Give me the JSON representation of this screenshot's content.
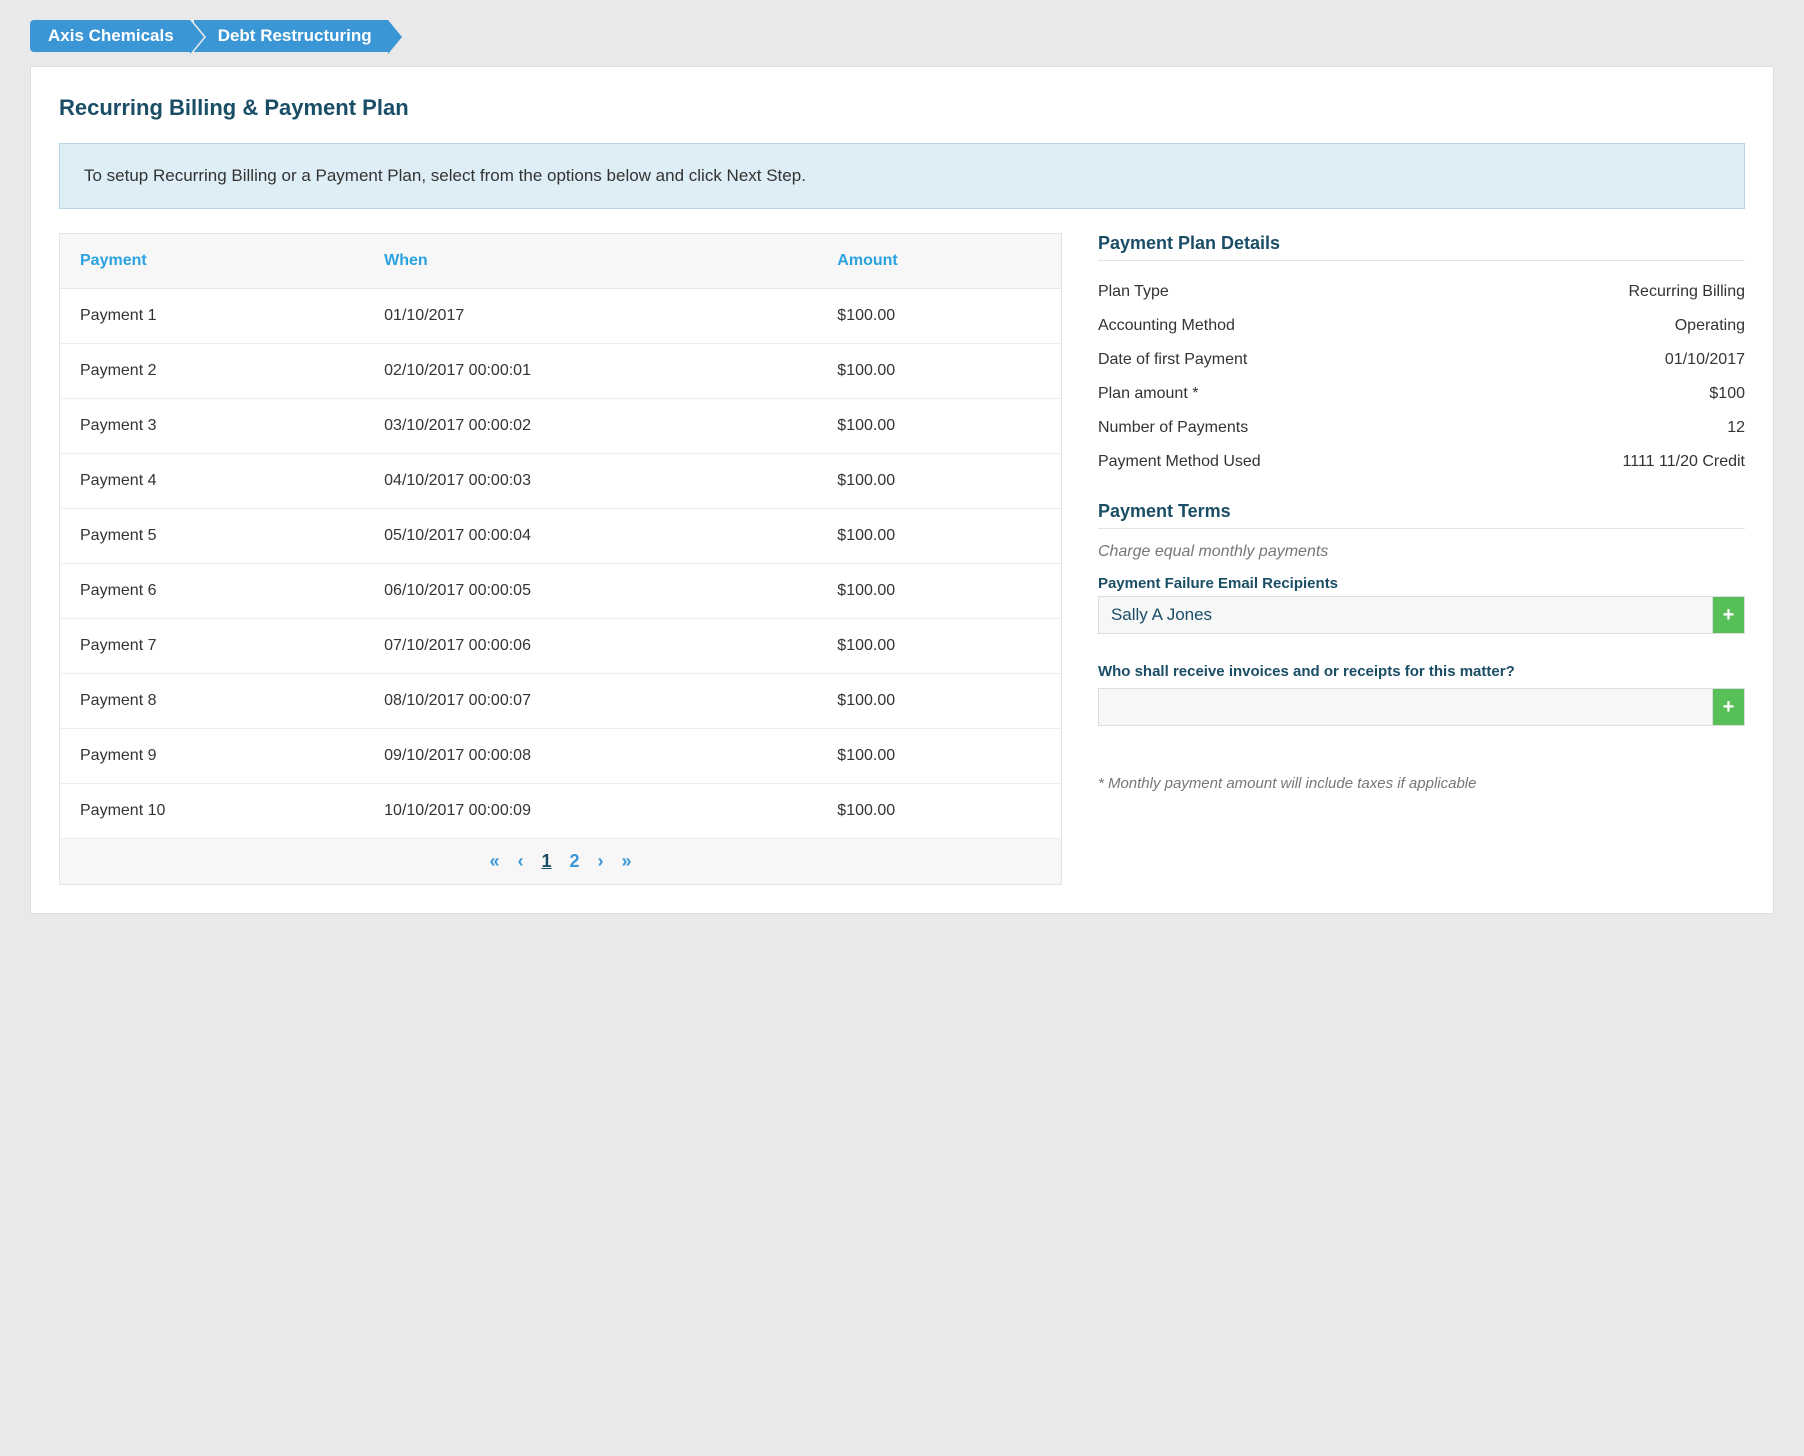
{
  "breadcrumb": {
    "item1": "Axis Chemicals",
    "item2": "Debt Restructuring"
  },
  "page": {
    "title": "Recurring Billing & Payment Plan",
    "info": "To setup Recurring Billing or a Payment Plan, select from the options below and click Next Step."
  },
  "table": {
    "headers": {
      "payment": "Payment",
      "when": "When",
      "amount": "Amount"
    },
    "rows": [
      {
        "payment": "Payment 1",
        "when": "01/10/2017",
        "amount": "$100.00"
      },
      {
        "payment": "Payment 2",
        "when": "02/10/2017 00:00:01",
        "amount": "$100.00"
      },
      {
        "payment": "Payment 3",
        "when": "03/10/2017 00:00:02",
        "amount": "$100.00"
      },
      {
        "payment": "Payment 4",
        "when": "04/10/2017 00:00:03",
        "amount": "$100.00"
      },
      {
        "payment": "Payment 5",
        "when": "05/10/2017 00:00:04",
        "amount": "$100.00"
      },
      {
        "payment": "Payment 6",
        "when": "06/10/2017 00:00:05",
        "amount": "$100.00"
      },
      {
        "payment": "Payment 7",
        "when": "07/10/2017 00:00:06",
        "amount": "$100.00"
      },
      {
        "payment": "Payment 8",
        "when": "08/10/2017 00:00:07",
        "amount": "$100.00"
      },
      {
        "payment": "Payment 9",
        "when": "09/10/2017 00:00:08",
        "amount": "$100.00"
      },
      {
        "payment": "Payment 10",
        "when": "10/10/2017 00:00:09",
        "amount": "$100.00"
      }
    ],
    "pagination": {
      "first": "«",
      "prev": "‹",
      "p1": "1",
      "p2": "2",
      "next": "›",
      "last": "»"
    }
  },
  "details": {
    "title": "Payment Plan Details",
    "rows": [
      {
        "label": "Plan Type",
        "value": "Recurring Billing"
      },
      {
        "label": "Accounting Method",
        "value": "Operating"
      },
      {
        "label": "Date of first Payment",
        "value": "01/10/2017"
      },
      {
        "label": "Plan amount *",
        "value": "$100"
      },
      {
        "label": "Number of Payments",
        "value": "12"
      },
      {
        "label": "Payment Method Used",
        "value": "1111 11/20 Credit"
      }
    ],
    "termsTitle": "Payment Terms",
    "termsText": "Charge equal monthly payments",
    "recipientsLabel": "Payment Failure Email Recipients",
    "recipientName": "Sally A Jones",
    "invoiceQuestion": "Who shall receive invoices and or receipts for this matter?",
    "footnote": "* Monthly payment amount will include taxes if applicable"
  }
}
